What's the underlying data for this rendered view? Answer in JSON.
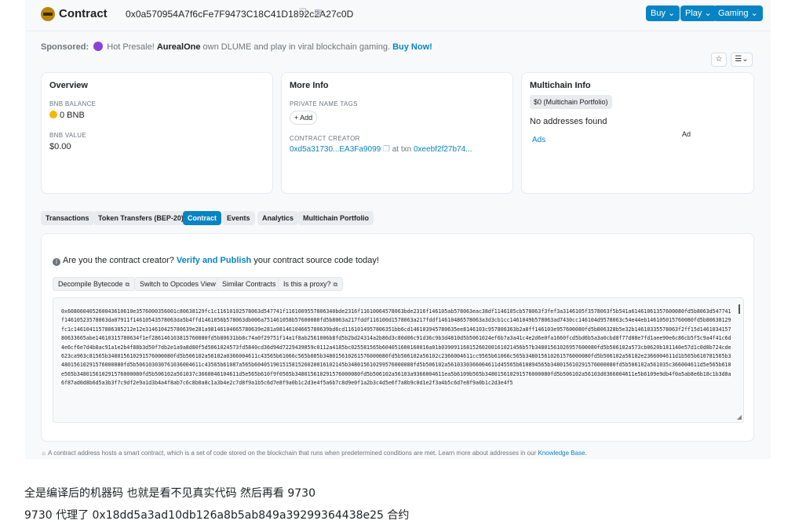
{
  "header": {
    "title": "Contract",
    "address": "0x0a570954A7f6cFe7F9473C18C41D1892c2A27c0D",
    "buttons": [
      "Buy ⌄",
      "Play ⌄",
      "Gaming ⌄"
    ]
  },
  "sponsored": {
    "label": "Sponsored:",
    "text_pre": "Hot Presale!",
    "brand": "AurealOne",
    "text_post": "own DLUME and play in viral blockchain gaming.",
    "cta": "Buy Now!"
  },
  "overview": {
    "title": "Overview",
    "balance_label": "BNB BALANCE",
    "balance_value": "0 BNB",
    "value_label": "BNB VALUE",
    "value_value": "$0.00"
  },
  "more_info": {
    "title": "More Info",
    "tags_label": "PRIVATE NAME TAGS",
    "add_label": "+ Add",
    "creator_label": "CONTRACT CREATOR",
    "creator_addr": "0xd5a31730...EA3Fa9099",
    "at_txn": "at txn",
    "txn_hash": "0xeebf2f27b74..."
  },
  "multichain": {
    "title": "Multichain Info",
    "portfolio": "$0 (Multichain Portfolio)",
    "no_addresses": "No addresses found",
    "ads": "Ads",
    "ad": "Ad"
  },
  "tabs": [
    {
      "label": "Transactions"
    },
    {
      "label": "Token Transfers (BEP-20)"
    },
    {
      "label": "Contract",
      "active": true
    },
    {
      "label": "Events"
    },
    {
      "label": "Analytics"
    },
    {
      "label": "Multichain Portfolio"
    }
  ],
  "contract": {
    "notice_pre": "Are you the contract creator?",
    "notice_link": "Verify and Publish",
    "notice_post": "your contract source code today!",
    "tools": [
      "Decompile Bytecode",
      "Switch to Opcodes View",
      "Similar Contracts",
      "Is this a proxy?"
    ],
    "bytecode": "0x608060405260043610610e3576000356001c80638129fc1c11610102578063d547741f1161009557806340bde2316f11610064578063bde2316f146105ab578063eac38df1146105cb578063f3fef3a3146105f3578063f5b541a61461061357600080fd5b8063d547741f14610523578063da07911f14610543578063da5b4ffd1461056b578063db006a751461058b57600080fd5b8063a217fddf116100d1578063a217fddf14610486578063a3d3cb1cc1461049b578063ad7430cc146104d9578063c54e44eb146105015760080fd5b80638129fc1c1461041157806385212e12e314610425780639e281a98146104665780639e281a98146104665780639bd6cd1161014957806351bb6cd146103945780635ee8146103c957806363b2a8ff146103e957600080fd5b806328b5e32b14610335578063f2ff15d146103415780633665abe14610315780634f1ef286146103815760080fd5b80631bb8c74a0f29751f14a1f8ab2561006b8fd5b2bd24314a2b86d3c80d06c91d36c9b3d4810d5b5061024ef6b7a3a41c4e2d6e0fa1660fcd5bd6b5a3a0cbd8f77d08e7fd1aee90e6c86cb5f5c9a4f41c6d4e6cf6e7d4b8ac91a1e2b4f88b3d50f7db2e1a9a8d80f5d5061024573fd5840cd36d94d7229439859c0112a4185bc025581565b604051600160016a01b03909116815260200161021456b57b34801561026957600080fd5b506102a573cb0620b181140e57d1c0d8b724cde623ca963c81565b348015610291576000080fd5b506102a56102a0366004611c43565b61066c565b005b348015610261576000080fd5b506102a56102c2366004611cc9565b61066c565b348015610261576000080fd5b506102a56102e2366004611d1b565b610781565b348015610291576000080fd5b506103030761036004611c43565b61087a565b60405190151581526020016102145b348015610299576000080fd5b506102a5610330366004611d45565b610894565b348015610291576000080fd5b506102a561035c366004611d5e565b610e565b348015610291576000080fd5b506102a561037c3660046104611d5e565b610f9f0565b348015610291576000080fd5b506102a56103a9366004611ea5b6109b565b348015610291576000080fd5b506102a56103d0366004611e5b6109e9db4f0a5ab8e6b18c1b3d8a6f87ad0d8b6d5a3b3f7c9df2e9a1d3b4a4f8ab7c6c8b0a8c1a3b4e2c7d8f9a1b5c6d7e8f9a0b1c2d3e4f5a6b7c8d9e0f1a2b3c4d5e6f7a8b9c0d1e2f3a4b5c6d7e8f9a0b1c2d3e4f5"
  },
  "footnote": {
    "text": "A contract address hosts a smart contract, which is a set of code stored on the blockchain that runs when predetermined conditions are met. Learn more about addresses in our",
    "link": "Knowledge Base."
  },
  "notes": {
    "line1": "全是编译后的机器码 也就是看不见真实代码 然后再看 9730",
    "line2": "9730 代理了 0x18dd5a3ad10db126a8b5ab849a39299364438e25 合约"
  }
}
